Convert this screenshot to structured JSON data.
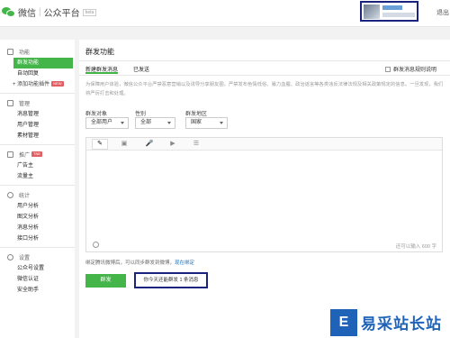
{
  "header": {
    "brand": "微信",
    "sub": "公众平台",
    "beta": "beta",
    "logout": "退出"
  },
  "sidebar": {
    "sections": [
      {
        "title": "功能",
        "items": [
          "群发功能",
          "自动回复",
          "+ 添加功能插件"
        ],
        "add_badge": "NEW"
      },
      {
        "title": "管理",
        "items": [
          "消息管理",
          "用户管理",
          "素材管理"
        ]
      },
      {
        "title": "推广",
        "title_badge": "TNE",
        "items": [
          "广告主",
          "流量主"
        ]
      },
      {
        "title": "统计",
        "items": [
          "用户分析",
          "图文分析",
          "消息分析",
          "接口分析"
        ]
      },
      {
        "title": "设置",
        "items": [
          "公众号设置",
          "微信认证",
          "安全助手"
        ]
      }
    ]
  },
  "main": {
    "title": "群发功能",
    "tabs": [
      "新建群发消息",
      "已发送"
    ],
    "rule_link": "群发消息规则说明",
    "notice": "为保障用户体验，微信公众平台严禁恶意营销以及诱导分享朋友圈，严禁发布色情低俗、暴力血腥、政治谣言等各类违反法律法规及相关政策规定的信息。一旦发现，我们将严厉打击和处理。",
    "filters": {
      "target_label": "群发对象",
      "target_value": "全部用户",
      "gender_label": "性别",
      "gender_value": "全部",
      "region_label": "群发地区",
      "region_value": "国家"
    },
    "editor": {
      "tools": [
        "✎",
        "▣",
        "🎤",
        "▶",
        "☰"
      ],
      "counter": "还可以输入 600 字"
    },
    "hint": "绑定腾讯微博后，可以同步群发到微博，",
    "hint_link": "现在绑定",
    "send_label": "群发",
    "quota": "你今天还能群发 1 条消息"
  },
  "watermark": {
    "logo": "E",
    "text": "易采站长站"
  },
  "colors": {
    "accent": "#44b549",
    "highlight_box": "#1a237e",
    "link": "#1a73c7"
  }
}
